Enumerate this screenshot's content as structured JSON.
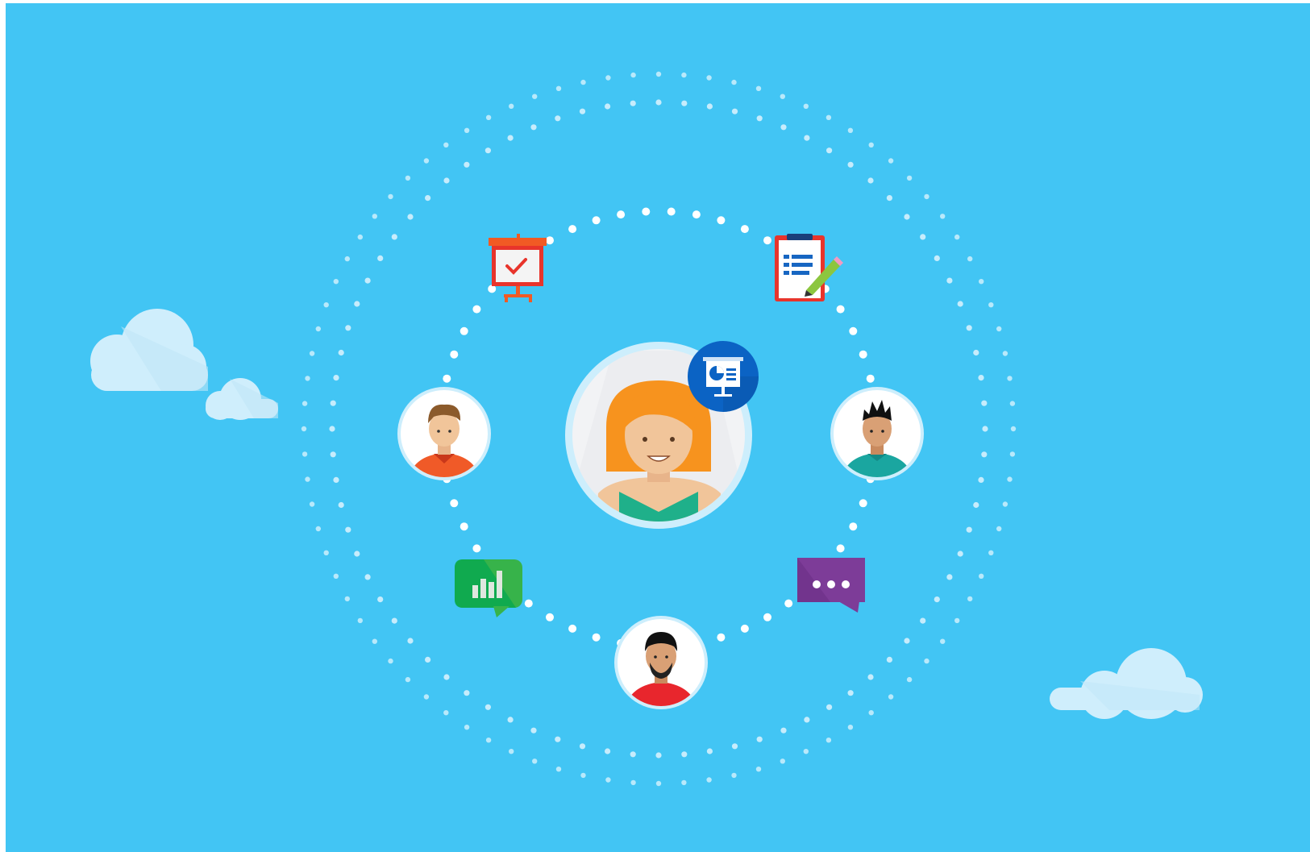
{
  "scene": {
    "background_color": "#42c5f4",
    "frame_color": "#ffffff",
    "dot_color_outer": "#cdeefc",
    "dot_color_inner": "#ffffff",
    "cloud_color": "#cfeefc",
    "cloud_shade": "#bfe6f7"
  },
  "center_person": {
    "description_icon": "woman-avatar-icon",
    "hair_color": "#f7931e",
    "shirt_color": "#1fb08a",
    "badge_icon": "presentation-chart-icon",
    "badge_color": "#0b63c4"
  },
  "satellites": [
    {
      "name": "man-brown-hair-avatar",
      "icon": "man-avatar-icon",
      "hair": "#8b5a2b",
      "shirt": "#f05a28"
    },
    {
      "name": "man-spiky-hair-avatar",
      "icon": "man-avatar-icon",
      "hair": "#111111",
      "shirt": "#1aa6a0"
    },
    {
      "name": "man-beard-avatar",
      "icon": "man-avatar-icon",
      "hair": "#111111",
      "shirt": "#e8262d"
    }
  ],
  "icons": [
    {
      "name": "whiteboard-check-icon",
      "color": "#f15a24"
    },
    {
      "name": "clipboard-list-icon",
      "color": "#e8342b"
    },
    {
      "name": "bar-chart-message-icon",
      "color": "#37b34a"
    },
    {
      "name": "chat-bubble-ellipsis-icon",
      "color": "#7d3c98"
    }
  ]
}
